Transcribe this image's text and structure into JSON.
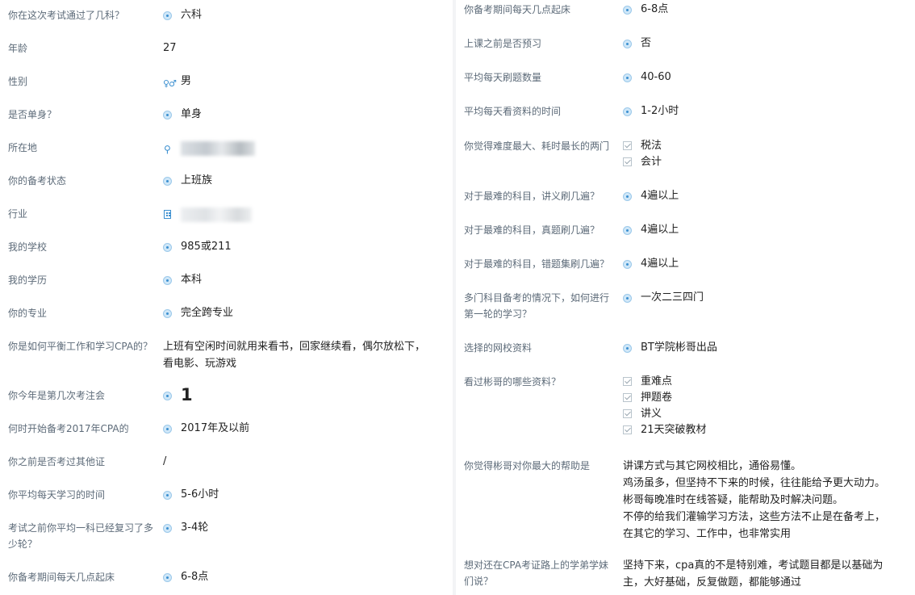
{
  "left": [
    {
      "q": "你在这次考试通过了几科？",
      "a": "六科"
    },
    {
      "q": "年龄",
      "a": "27"
    },
    {
      "q": "性别",
      "a": "男"
    },
    {
      "q": "是否单身？",
      "a": "单身"
    },
    {
      "q": "所在地",
      "a": ""
    },
    {
      "q": "你的备考状态",
      "a": "上班族"
    },
    {
      "q": "行业",
      "a": ""
    },
    {
      "q": "我的学校",
      "a": "985或211"
    },
    {
      "q": "我的学历",
      "a": "本科"
    },
    {
      "q": "你的专业",
      "a": "完全跨专业"
    },
    {
      "q": "你是如何平衡工作和学习CPA的？",
      "a": "上班有空闲时间就用来看书，回家继续看，偶尔放松下，\n看电影、玩游戏"
    },
    {
      "q": "你今年是第几次考注会",
      "a": "1"
    },
    {
      "q": "何时开始备考2017年CPA的",
      "a": "2017年及以前"
    },
    {
      "q": "你之前是否考过其他证",
      "a": "/"
    },
    {
      "q": "你平均每天学习的时间",
      "a": "5-6小时"
    },
    {
      "q": "考试之前你平均一科已经复习了多\n少轮？",
      "a": "3-4轮"
    },
    {
      "q": "你备考期间每天几点起床",
      "a": "6-8点"
    }
  ],
  "right": [
    {
      "q": "你备考期间每天几点起床",
      "a": "6-8点"
    },
    {
      "q": "上课之前是否预习",
      "a": "否"
    },
    {
      "q": "平均每天刷题数量",
      "a": "40-60"
    },
    {
      "q": "平均每天看资料的时间",
      "a": "1-2小时"
    },
    {
      "q": "你觉得难度最大、耗时最长的两门",
      "a1": "税法",
      "a2": "会计"
    },
    {
      "q": "对于最难的科目，讲义刷几遍？",
      "a": "4遍以上"
    },
    {
      "q": "对于最难的科目，真题刷几遍？",
      "a": "4遍以上"
    },
    {
      "q": "对于最难的科目，错题集刷几遍？",
      "a": "4遍以上"
    },
    {
      "q": "多门科目备考的情况下，如何进行\n第一轮的学习？",
      "a": "一次二三四门"
    },
    {
      "q": "选择的网校资料",
      "a": "BT学院彬哥出品"
    },
    {
      "q": "看过彬哥的哪些资料？",
      "a1": "重难点",
      "a2": "押题卷",
      "a3": "讲义",
      "a4": "21天突破教材"
    },
    {
      "q": "你觉得彬哥对你最大的帮助是",
      "a": "讲课方式与其它网校相比，通俗易懂。\n鸡汤虽多，但坚持不下来的时候，往往能给予更大动力。\n彬哥每晚准时在线答疑，能帮助及时解决问题。\n不停的给我们灌输学习方法，这些方法不止是在备考上，\n在其它的学习、工作中，也非常实用"
    },
    {
      "q": "想对还在CPA考证路上的学弟学妹\n们说？",
      "a": "坚持下来，cpa真的不是特别难，考试题目都是以基础为\n主，大好基础，反复做题，都能够通过"
    }
  ]
}
